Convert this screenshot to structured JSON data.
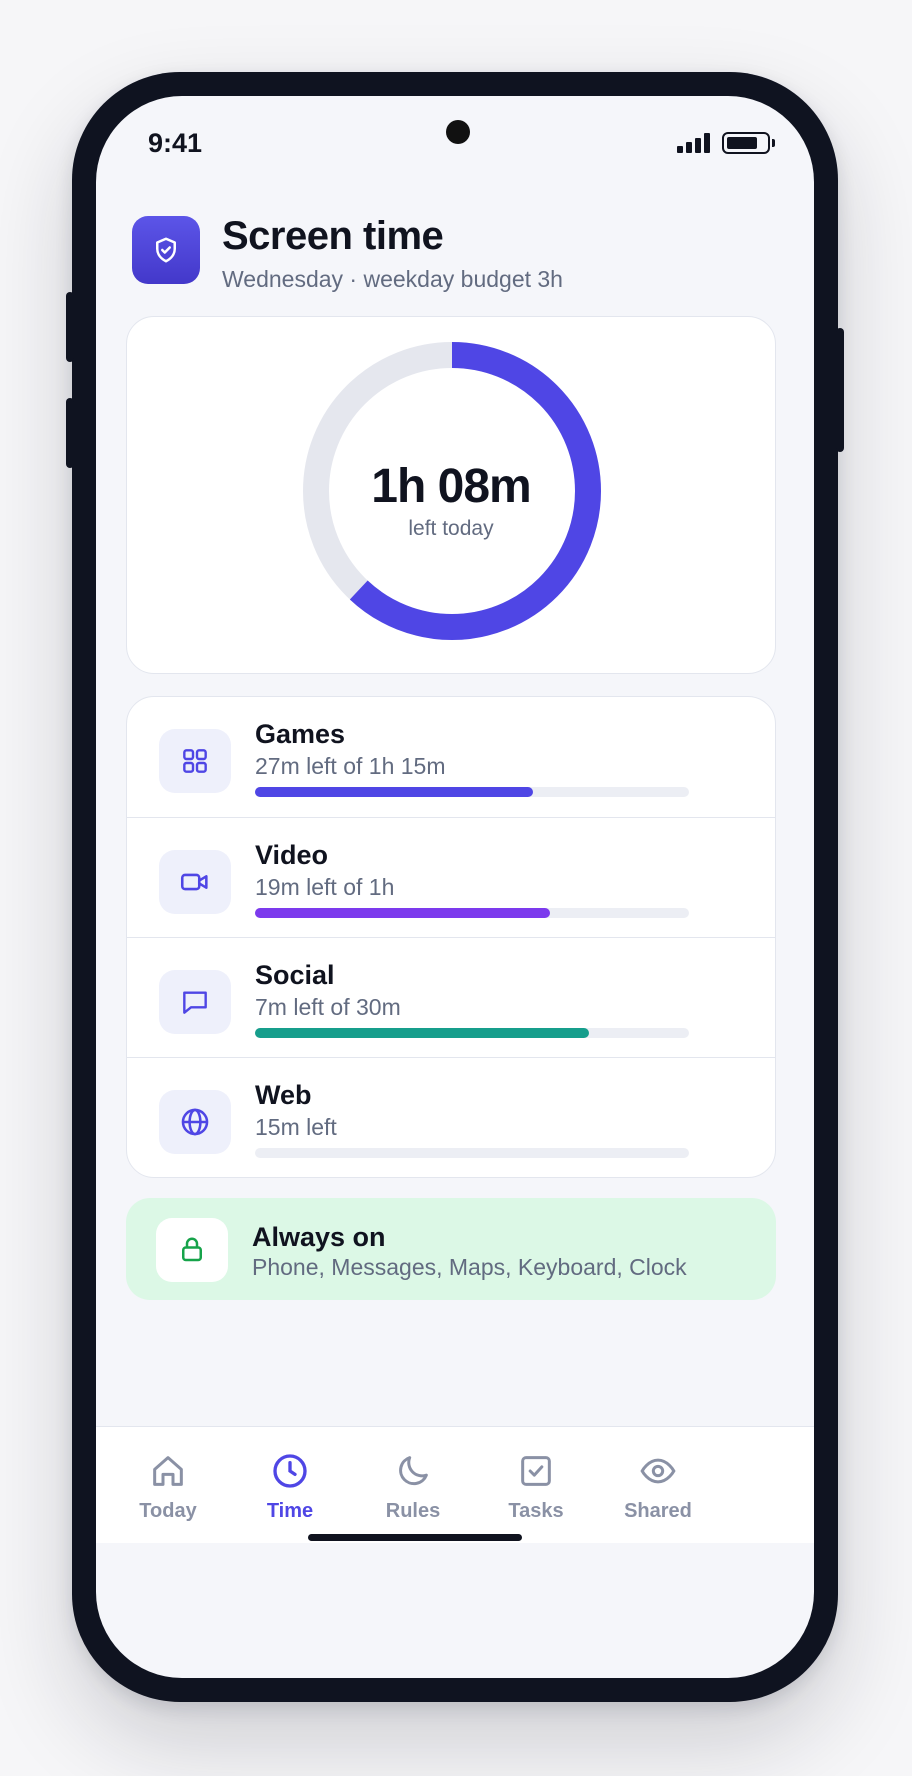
{
  "status_bar": {
    "time": "9:41"
  },
  "header": {
    "title": "Screen time",
    "subtitle": "Wednesday · weekday budget 3h",
    "icon": "shield-check-icon"
  },
  "ring": {
    "value": "1h 08m",
    "label": "left today",
    "fraction_used": 0.62,
    "color": "#4f46e5",
    "track_color": "#e5e7ee"
  },
  "categories": [
    {
      "name": "Games",
      "detail": "27m left of 1h 15m",
      "icon": "grid-icon",
      "progress": 0.64,
      "color": "#4f46e5"
    },
    {
      "name": "Video",
      "detail": "19m left of 1h",
      "icon": "video-icon",
      "progress": 0.68,
      "color": "#7c3aed"
    },
    {
      "name": "Social",
      "detail": "7m left of 30m",
      "icon": "chat-icon",
      "progress": 0.77,
      "color": "#169e8c"
    },
    {
      "name": "Web",
      "detail": "15m left",
      "icon": "globe-icon",
      "progress": 0,
      "color": "#4f46e5"
    }
  ],
  "always_on": {
    "title": "Always on",
    "apps": "Phone, Messages, Maps, Keyboard, Clock",
    "icon": "lock-icon",
    "background": "#dcf8e6"
  },
  "tabs": [
    {
      "label": "Today",
      "icon": "home-icon",
      "active": false
    },
    {
      "label": "Time",
      "icon": "clock-icon",
      "active": true
    },
    {
      "label": "Rules",
      "icon": "moon-icon",
      "active": false
    },
    {
      "label": "Tasks",
      "icon": "checkbox-icon",
      "active": false
    },
    {
      "label": "Shared",
      "icon": "eye-icon",
      "active": false
    }
  ],
  "accent_color": "#4f46e5"
}
